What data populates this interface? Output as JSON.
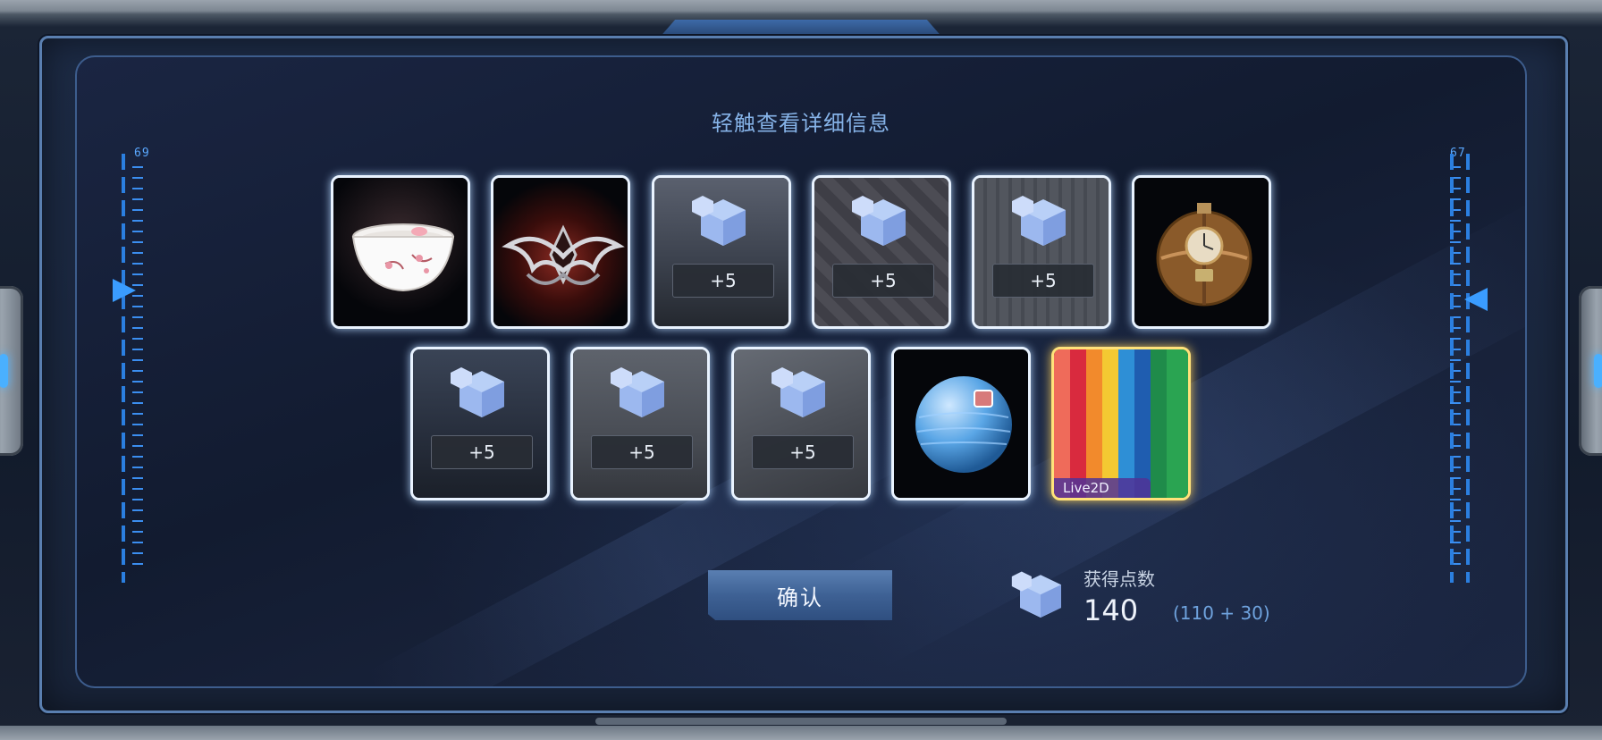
{
  "instruction": "轻触查看详细信息",
  "ruler_left": {
    "value": "69"
  },
  "ruler_right": {
    "value": "67"
  },
  "items": [
    {
      "id": "bowl",
      "kind": "image",
      "icon": "porcelain-bowl-icon"
    },
    {
      "id": "emblem",
      "kind": "image",
      "icon": "winged-emblem-icon"
    },
    {
      "id": "room1",
      "kind": "points",
      "bonus": "+5",
      "icon": "points-cube-icon"
    },
    {
      "id": "room2",
      "kind": "points",
      "bonus": "+5",
      "icon": "points-cube-icon"
    },
    {
      "id": "room3",
      "kind": "points",
      "bonus": "+5",
      "icon": "points-cube-icon"
    },
    {
      "id": "clock",
      "kind": "image",
      "icon": "clock-orb-icon"
    },
    {
      "id": "room4",
      "kind": "points",
      "bonus": "+5",
      "icon": "points-cube-icon"
    },
    {
      "id": "room5",
      "kind": "points",
      "bonus": "+5",
      "icon": "points-cube-icon"
    },
    {
      "id": "room6",
      "kind": "points",
      "bonus": "+5",
      "icon": "points-cube-icon"
    },
    {
      "id": "ball",
      "kind": "image",
      "icon": "blue-ball-icon"
    },
    {
      "id": "live2d",
      "kind": "live2d",
      "label": "Live2D",
      "icon": "rainbow-stripes-icon"
    }
  ],
  "confirm_label": "确认",
  "points": {
    "label": "获得点数",
    "value": "140",
    "breakdown": "(110 + 30)"
  },
  "colors": {
    "accent": "#5aa8ff",
    "item_border": "#e9f3ff",
    "highlight_border": "#ffe27a"
  }
}
